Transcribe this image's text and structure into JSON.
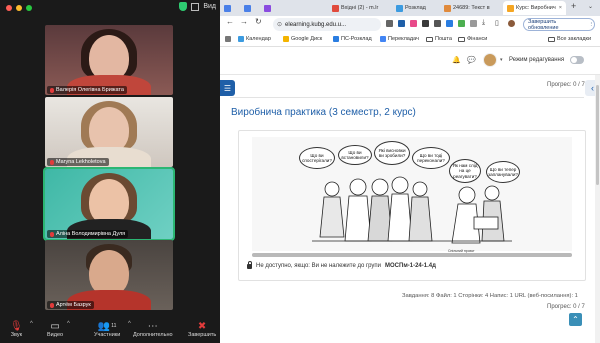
{
  "zoom": {
    "top_view_label": "Вид",
    "participants": [
      {
        "name": "Валерія Олегівна Брижата",
        "muted": true,
        "active": false
      },
      {
        "name": "Maryna Lekholetova",
        "muted": true,
        "active": false
      },
      {
        "name": "Аліна Володимирівна Дуля",
        "muted": true,
        "active": true
      },
      {
        "name": "Артём Базрук",
        "muted": true,
        "active": false
      }
    ],
    "toolbar": {
      "sound_label": "Звук",
      "video_label": "Видео",
      "participants_label": "Участники",
      "participants_count": "11",
      "more_label": "Дополнительно",
      "end_label": "Завершить"
    }
  },
  "browser": {
    "tabs": [
      {
        "label": "",
        "active": false
      },
      {
        "label": "",
        "active": false
      },
      {
        "label": "",
        "active": false
      },
      {
        "label": "Вхідні (2) - m.lr",
        "active": false
      },
      {
        "label": "Розклад",
        "active": false
      },
      {
        "label": "24689: Текст в",
        "active": false
      },
      {
        "label": "Курс: Виробнич",
        "active": true
      }
    ],
    "url": "elearning.kubg.edu.u...",
    "update_button": "Завершить обновление",
    "bookmarks": [
      "Календар",
      "Google Диск",
      "ПС-Розклад",
      "Перекладач",
      "Пошта",
      "Фінанси"
    ],
    "all_bookmarks": "Все закладки"
  },
  "moodle": {
    "edit_mode_label": "Режим редагування",
    "progress_top": "Прогрес: 0 / 7",
    "section_title": "Виробнича практика (3 семестр, 2 курс)",
    "cartoon_bubbles": [
      "Що ви спостерігали?",
      "Що ви встановили?",
      "Які висновки ви зробили?",
      "Що ви тоді переконали?",
      "Як нам слід на це реагувати?",
      "Що ви тепер запланували?"
    ],
    "cartoon_caption": "Спільний проєкт",
    "restriction_text": "Не доступно, якщо: Ви не належите до групи",
    "restriction_group": "МОСПм-1-24-1.4д",
    "stats": "Завдання: 8   Файл: 1   Сторінки: 4   Напис: 1   URL (веб-посилання): 1",
    "progress_bottom": "Прогрес: 0 / 7"
  },
  "colors": {
    "moodle_blue": "#1f5fa8",
    "zoom_active": "#2bb673",
    "mute_red": "#e23b3b"
  }
}
